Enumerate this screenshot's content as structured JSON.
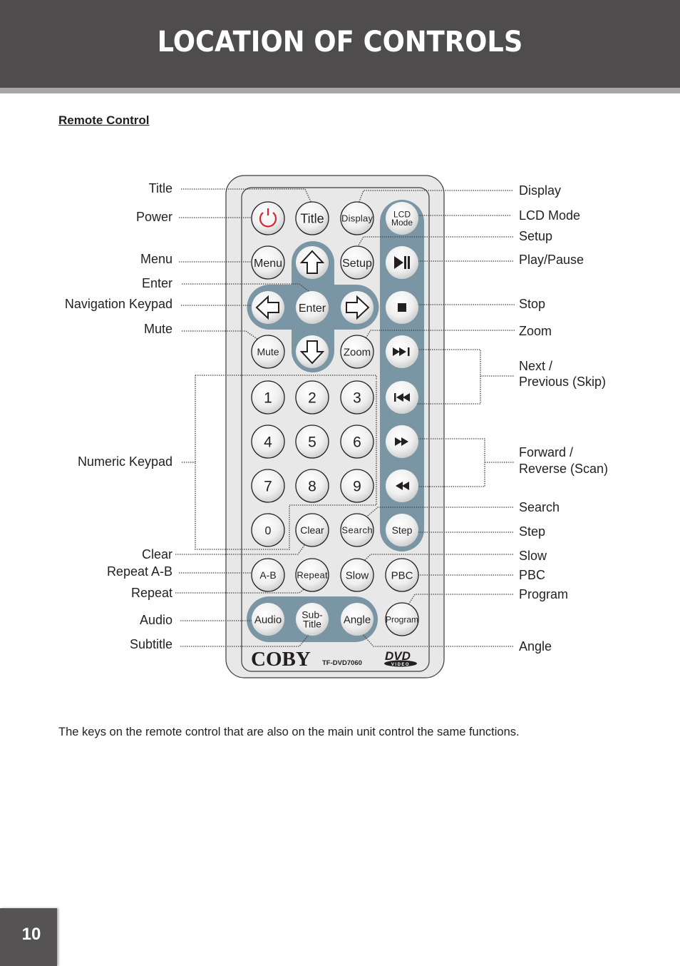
{
  "header": {
    "title": "LOCATION OF CONTROLS"
  },
  "section": {
    "title": "Remote Control"
  },
  "left_labels": [
    {
      "id": "title",
      "text": "Title"
    },
    {
      "id": "power",
      "text": "Power"
    },
    {
      "id": "menu",
      "text": "Menu"
    },
    {
      "id": "enter",
      "text": "Enter"
    },
    {
      "id": "navigation-keypad",
      "text": "Navigation Keypad"
    },
    {
      "id": "mute",
      "text": "Mute"
    },
    {
      "id": "numeric-keypad",
      "text": "Numeric Keypad"
    },
    {
      "id": "clear",
      "text": "Clear"
    },
    {
      "id": "repeat-ab",
      "text": "Repeat A-B"
    },
    {
      "id": "repeat",
      "text": "Repeat"
    },
    {
      "id": "audio",
      "text": "Audio"
    },
    {
      "id": "subtitle",
      "text": "Subtitle"
    }
  ],
  "right_labels": [
    {
      "id": "display",
      "text": "Display"
    },
    {
      "id": "lcd-mode",
      "text": "LCD Mode"
    },
    {
      "id": "setup",
      "text": "Setup"
    },
    {
      "id": "play-pause",
      "text": "Play/Pause"
    },
    {
      "id": "stop",
      "text": "Stop"
    },
    {
      "id": "zoom",
      "text": "Zoom"
    },
    {
      "id": "next-previous-line1",
      "text": "Next /"
    },
    {
      "id": "next-previous-line2",
      "text": "Previous (Skip)"
    },
    {
      "id": "forward-reverse-line1",
      "text": "Forward /"
    },
    {
      "id": "forward-reverse-line2",
      "text": "Reverse (Scan)"
    },
    {
      "id": "search",
      "text": "Search"
    },
    {
      "id": "step",
      "text": "Step"
    },
    {
      "id": "slow",
      "text": "Slow"
    },
    {
      "id": "pbc",
      "text": "PBC"
    },
    {
      "id": "program",
      "text": "Program"
    },
    {
      "id": "angle",
      "text": "Angle"
    }
  ],
  "remote": {
    "buttons": {
      "title": "Title",
      "display": "Display",
      "lcd_mode_1": "LCD",
      "lcd_mode_2": "Mode",
      "menu": "Menu",
      "setup": "Setup",
      "enter": "Enter",
      "mute": "Mute",
      "zoom": "Zoom",
      "n1": "1",
      "n2": "2",
      "n3": "3",
      "n4": "4",
      "n5": "5",
      "n6": "6",
      "n7": "7",
      "n8": "8",
      "n9": "9",
      "n0": "0",
      "clear": "Clear",
      "search": "Search",
      "step": "Step",
      "ab": "A-B",
      "repeat": "Repeat",
      "slow": "Slow",
      "pbc": "PBC",
      "audio": "Audio",
      "subtitle_1": "Sub-",
      "subtitle_2": "Title",
      "angle": "Angle",
      "program": "Program"
    },
    "icons": {
      "power": "power-icon",
      "up": "arrow-up-icon",
      "down": "arrow-down-icon",
      "left": "arrow-left-icon",
      "right": "arrow-right-icon",
      "play_pause": "play-pause-icon",
      "stop": "stop-icon",
      "next": "skip-next-icon",
      "previous": "skip-previous-icon",
      "forward": "fast-forward-icon",
      "reverse": "rewind-icon"
    },
    "brand": "COBY",
    "model": "TF-DVD7060",
    "logo_top": "DVD",
    "logo_bottom": "VIDEO",
    "colors": {
      "accent_panel": "#7a95a3",
      "power_red": "#d7272f",
      "body": "#e8e8e8"
    }
  },
  "footnote": "The keys on the remote control that are also on the main unit control the same functions.",
  "page_number": "10"
}
